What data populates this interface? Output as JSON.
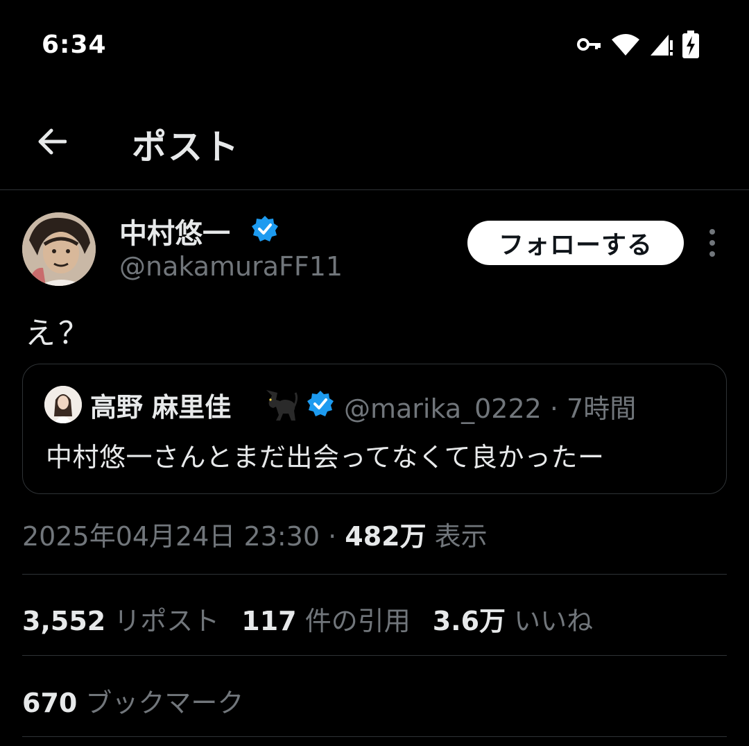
{
  "status_bar": {
    "time": "6:34",
    "icons": [
      "vpn-key-icon",
      "wifi-icon",
      "signal-icon",
      "battery-charging-icon"
    ]
  },
  "header": {
    "title": "ポスト",
    "back_icon": "arrow-left-icon"
  },
  "author": {
    "name": "中村悠一",
    "handle": "@nakamuraFF11",
    "verified": true,
    "follow_label": "フォローする"
  },
  "post": {
    "text": "え？"
  },
  "quote": {
    "name": "高野 麻里佳",
    "emoji": "🐈‍⬛",
    "handle_time": "@marika_0222 · 7時間",
    "verified": true,
    "text": "中村悠一さんとまだ出会ってなくて良かったー"
  },
  "meta": {
    "datetime": "2025年04月24日 23:30 · ",
    "views_count": "482万",
    "views_label": " 表示"
  },
  "stats": {
    "reposts_count": "3,552",
    "reposts_label": " リポスト",
    "quotes_count": "117",
    "quotes_label": " 件の引用",
    "likes_count": "3.6万",
    "likes_label": " いいね",
    "bookmarks_count": "670",
    "bookmarks_label": " ブックマーク"
  },
  "colors": {
    "background": "#000000",
    "text_primary": "#e7e9ea",
    "text_secondary": "#71767b",
    "divider": "#2f3336",
    "verified": "#1d9bf0"
  }
}
